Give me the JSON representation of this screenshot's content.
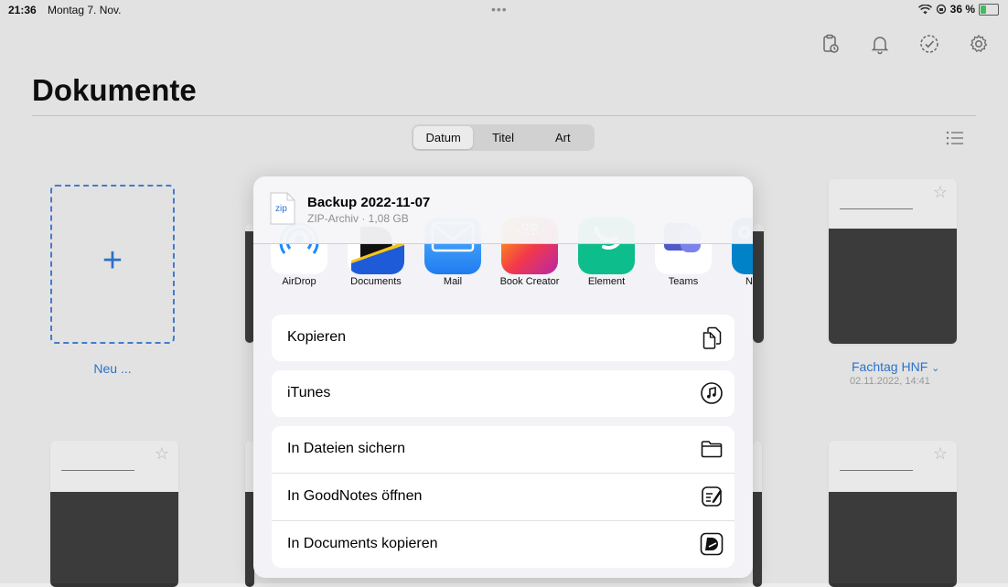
{
  "status_bar": {
    "time": "21:36",
    "date": "Montag 7. Nov.",
    "battery": "36 %",
    "battery_level": 0.36
  },
  "page": {
    "title": "Dokumente"
  },
  "sort_segments": [
    "Datum",
    "Titel",
    "Art"
  ],
  "selected_segment": "Datum",
  "new_tile": {
    "plus": "+",
    "label": "Neu ..."
  },
  "documents": [
    {
      "name": "Fachtag HNF",
      "chevron": "⌄",
      "date": "02.11.2022, 14:41"
    }
  ],
  "share_sheet": {
    "file_type_badge": "zip",
    "file_name": "Backup 2022-11-07",
    "file_meta": "ZIP-Archiv · 1,08 GB",
    "apps": [
      {
        "label": "AirDrop",
        "icon": "airdrop-icon",
        "color": "#ffffff"
      },
      {
        "label": "Documents",
        "icon": "documents-app-icon",
        "color": "#ffffff"
      },
      {
        "label": "Mail",
        "icon": "mail-app-icon",
        "color": "#3b9cf6"
      },
      {
        "label": "Book Creator",
        "icon": "book-creator-icon",
        "color": "#e8324f"
      },
      {
        "label": "Element",
        "icon": "element-app-icon",
        "color": "#0dbd8b"
      },
      {
        "label": "Teams",
        "icon": "teams-app-icon",
        "color": "#ffffff"
      },
      {
        "label": "Nex",
        "icon": "nextcloud-app-icon",
        "color": "#0082c9"
      }
    ],
    "action_groups": [
      [
        {
          "label": "Kopieren",
          "icon": "copy-icon"
        }
      ],
      [
        {
          "label": "iTunes",
          "icon": "music-note-icon"
        }
      ],
      [
        {
          "label": "In Dateien sichern",
          "icon": "folder-icon"
        },
        {
          "label": "In GoodNotes öffnen",
          "icon": "goodnotes-icon"
        },
        {
          "label": "In Documents kopieren",
          "icon": "documents-icon"
        }
      ]
    ]
  }
}
